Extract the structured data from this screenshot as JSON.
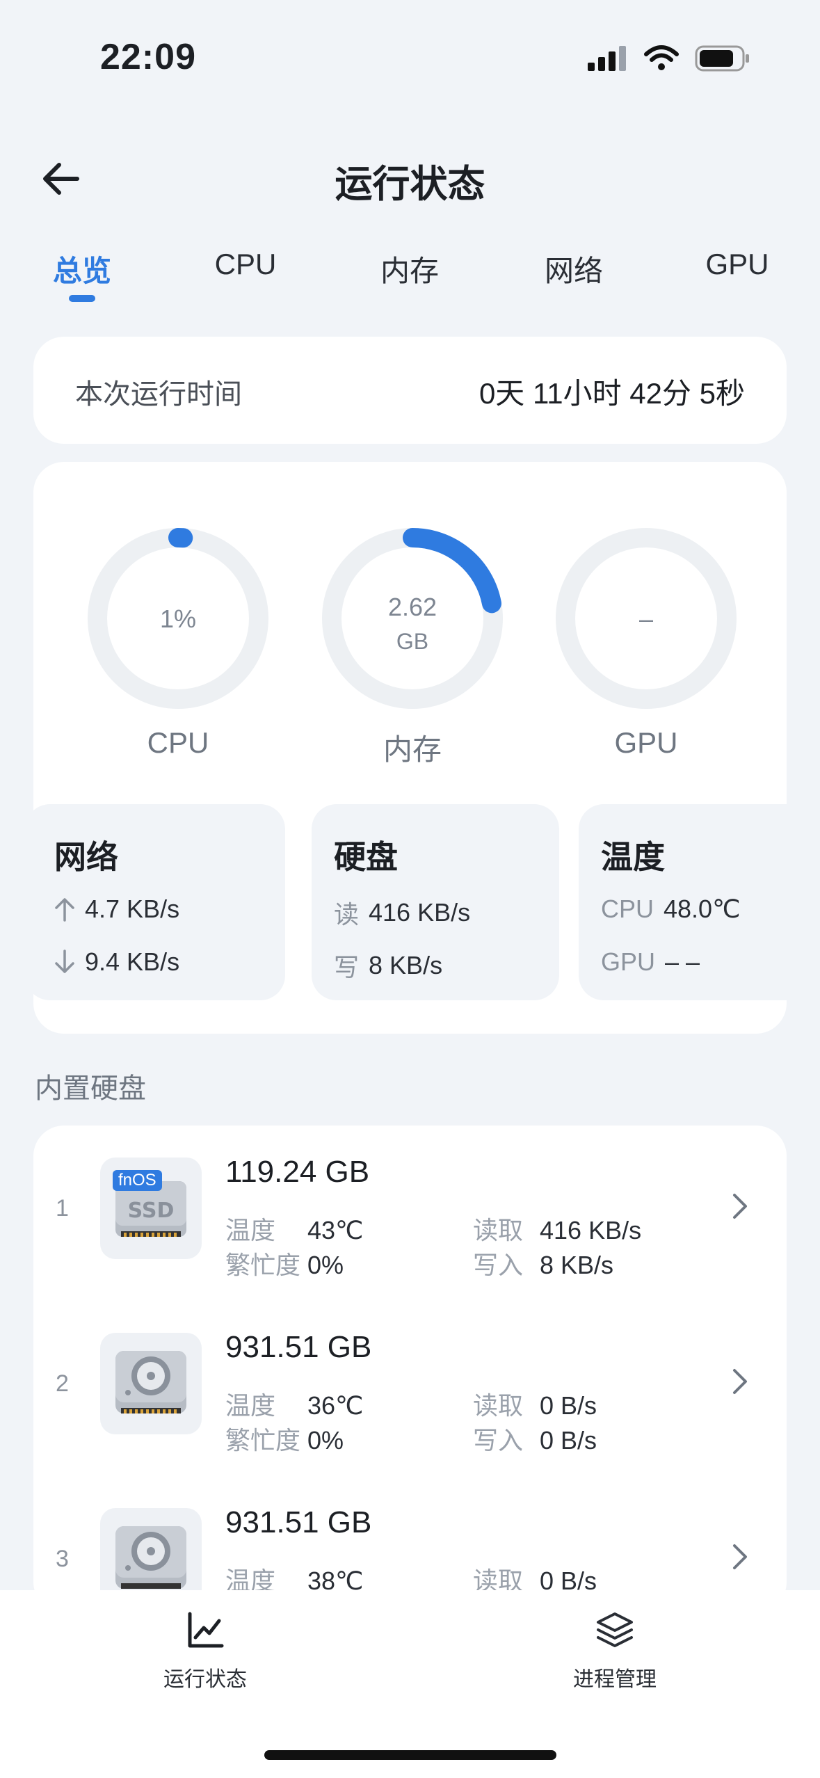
{
  "status_bar": {
    "time": "22:09"
  },
  "header": {
    "title": "运行状态"
  },
  "tabs": [
    {
      "label": "总览",
      "active": true
    },
    {
      "label": "CPU"
    },
    {
      "label": "内存"
    },
    {
      "label": "网络"
    },
    {
      "label": "GPU"
    }
  ],
  "uptime": {
    "label": "本次运行时间",
    "value": "0天 11小时 42分 5秒"
  },
  "gauges": {
    "cpu": {
      "label": "CPU",
      "value": "1%",
      "percent": 1
    },
    "memory": {
      "label": "内存",
      "value": "2.62",
      "unit": "GB",
      "percent": 22
    },
    "gpu": {
      "label": "GPU",
      "value": "–"
    }
  },
  "tiles": {
    "network": {
      "title": "网络",
      "up": "4.7 KB/s",
      "down": "9.4 KB/s"
    },
    "disk": {
      "title": "硬盘",
      "read_label": "读",
      "read": "416 KB/s",
      "write_label": "写",
      "write": "8 KB/s"
    },
    "temperature": {
      "title": "温度",
      "cpu_label": "CPU",
      "cpu": "48.0℃",
      "gpu_label": "GPU",
      "gpu": "–  –"
    }
  },
  "builtin_disks": {
    "title": "内置硬盘",
    "labels": {
      "temp": "温度",
      "busy": "繁忙度",
      "read": "读取",
      "write": "写入"
    },
    "disks": [
      {
        "index": "1",
        "size": "119.24 GB",
        "temp": "43℃",
        "busy": "0%",
        "read": "416 KB/s",
        "write": "8 KB/s",
        "type": "ssd",
        "badge": "fnOS",
        "icon_text": "SSD"
      },
      {
        "index": "2",
        "size": "931.51 GB",
        "temp": "36℃",
        "busy": "0%",
        "read": "0 B/s",
        "write": "0 B/s",
        "type": "hdd"
      },
      {
        "index": "3",
        "size": "931.51 GB",
        "temp": "38℃",
        "busy": "",
        "read": "0 B/s",
        "write": "",
        "type": "hdd"
      }
    ]
  },
  "bottom_nav": [
    {
      "label": "运行状态",
      "icon": "chart-line-icon",
      "active": true
    },
    {
      "label": "进程管理",
      "icon": "layers-icon"
    }
  ],
  "colors": {
    "accent": "#2f7be0",
    "track": "#edf0f3",
    "background": "#f1f4f8"
  }
}
